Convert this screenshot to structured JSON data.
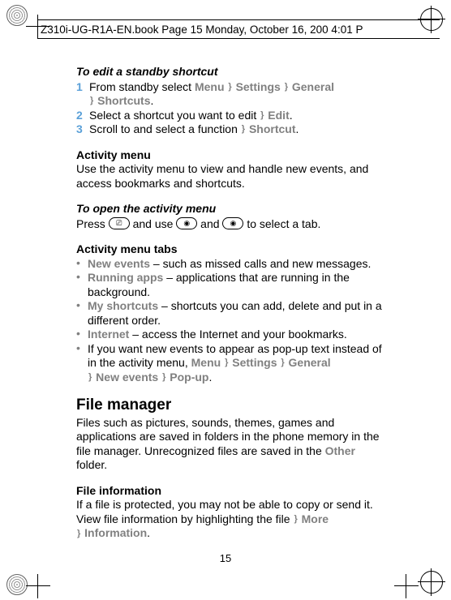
{
  "header": "Z310i-UG-R1A-EN.book  Page 15  Monday, October 16, 200    4:01 P",
  "page_number": "15",
  "sec1": {
    "title": "To edit a standby shortcut",
    "step1_pre": "From standby select ",
    "step1_m1": "Menu",
    "step1_m2": "Settings",
    "step1_m3": "General",
    "step1_m4": "Shortcuts",
    "step2_pre": "Select a shortcut you want to edit ",
    "step2_m1": "Edit",
    "step3_pre": "Scroll to and select a function ",
    "step3_m1": "Shortcut",
    "n1": "1",
    "n2": "2",
    "n3": "3"
  },
  "sec2": {
    "title": "Activity menu",
    "body": "Use the activity menu to view and handle new events, and access bookmarks and shortcuts."
  },
  "sec3": {
    "title": "To open the activity menu",
    "pre": "Press ",
    "mid": " and use ",
    "and": " and ",
    "post": " to select a tab."
  },
  "sec4": {
    "title": "Activity menu tabs",
    "b1_label": "New events",
    "b1_text": " – such as missed calls and new messages.",
    "b2_label": "Running apps",
    "b2_text": " – applications that are running in the background.",
    "b3_label": "My shortcuts",
    "b3_text": " – shortcuts you can add, delete and put in a different order.",
    "b4_label": "Internet",
    "b4_text": " – access the Internet and your bookmarks.",
    "b5_pre": "If you want new events to appear as pop-up text instead of in the activity menu, ",
    "b5_m1": "Menu",
    "b5_m2": "Settings",
    "b5_m3": "General",
    "b5_m4": "New events",
    "b5_m5": "Pop-up"
  },
  "sec5": {
    "title": "File manager",
    "body_pre": "Files such as pictures, sounds, themes, games and applications are saved in folders in the phone memory in the file manager. Unrecognized files are saved in the ",
    "other": "Other",
    "body_post": " folder."
  },
  "sec6": {
    "title": "File information",
    "body_pre": "If a file is protected, you may not be able to copy or send it. View file information by highlighting the file ",
    "m1": "More",
    "m2": "Information"
  },
  "arrow_glyph": "}"
}
